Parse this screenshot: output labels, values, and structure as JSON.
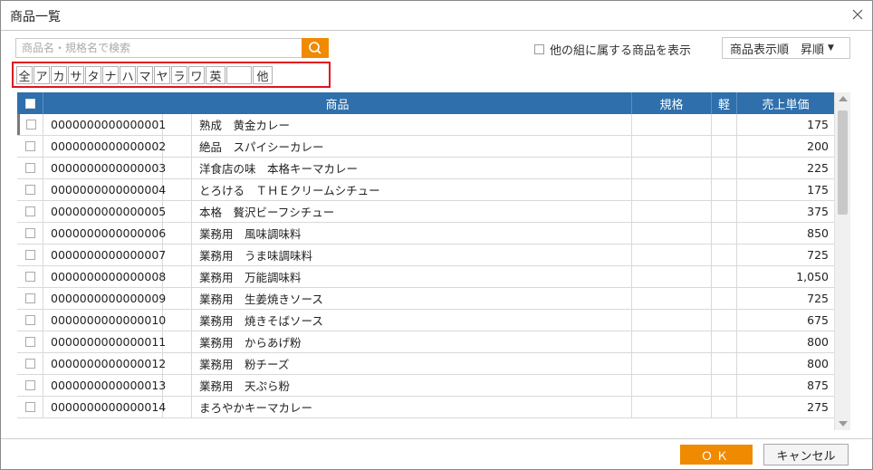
{
  "window": {
    "title": "商品一覧"
  },
  "search": {
    "placeholder": "商品名・規格名で検索"
  },
  "filters": {
    "other_group_label": "他の組に属する商品を表示",
    "sort_label": "商品表示順　昇順"
  },
  "kana": [
    "全",
    "ア",
    "カ",
    "サ",
    "タ",
    "ナ",
    "ハ",
    "マ",
    "ヤ",
    "ラ",
    "ワ",
    "英",
    "",
    "他"
  ],
  "table": {
    "columns": {
      "product": "商品",
      "spec": "規格",
      "light": "軽",
      "price": "売上単価"
    },
    "rows": [
      {
        "code": "0000000000000001",
        "name": "熟成　黄金カレー",
        "spec": "",
        "light": "",
        "price": "175"
      },
      {
        "code": "0000000000000002",
        "name": "絶品　スパイシーカレー",
        "spec": "",
        "light": "",
        "price": "200"
      },
      {
        "code": "0000000000000003",
        "name": "洋食店の味　本格キーマカレー",
        "spec": "",
        "light": "",
        "price": "225"
      },
      {
        "code": "0000000000000004",
        "name": "とろける　ＴＨＥクリームシチュー",
        "spec": "",
        "light": "",
        "price": "175"
      },
      {
        "code": "0000000000000005",
        "name": "本格　贅沢ビーフシチュー",
        "spec": "",
        "light": "",
        "price": "375"
      },
      {
        "code": "0000000000000006",
        "name": "業務用　風味調味料",
        "spec": "",
        "light": "",
        "price": "850"
      },
      {
        "code": "0000000000000007",
        "name": "業務用　うま味調味料",
        "spec": "",
        "light": "",
        "price": "725"
      },
      {
        "code": "0000000000000008",
        "name": "業務用　万能調味料",
        "spec": "",
        "light": "",
        "price": "1,050"
      },
      {
        "code": "0000000000000009",
        "name": "業務用　生姜焼きソース",
        "spec": "",
        "light": "",
        "price": "725"
      },
      {
        "code": "0000000000000010",
        "name": "業務用　焼きそばソース",
        "spec": "",
        "light": "",
        "price": "675"
      },
      {
        "code": "0000000000000011",
        "name": "業務用　からあげ粉",
        "spec": "",
        "light": "",
        "price": "800"
      },
      {
        "code": "0000000000000012",
        "name": "業務用　粉チーズ",
        "spec": "",
        "light": "",
        "price": "800"
      },
      {
        "code": "0000000000000013",
        "name": "業務用　天ぷら粉",
        "spec": "",
        "light": "",
        "price": "875"
      },
      {
        "code": "0000000000000014",
        "name": "まろやかキーマカレー",
        "spec": "",
        "light": "",
        "price": "275"
      }
    ]
  },
  "footer": {
    "ok_label": "ＯＫ",
    "cancel_label": "キャンセル"
  },
  "colors": {
    "accent": "#f08a00",
    "header": "#2f6fab",
    "highlight": "#e0141e"
  }
}
